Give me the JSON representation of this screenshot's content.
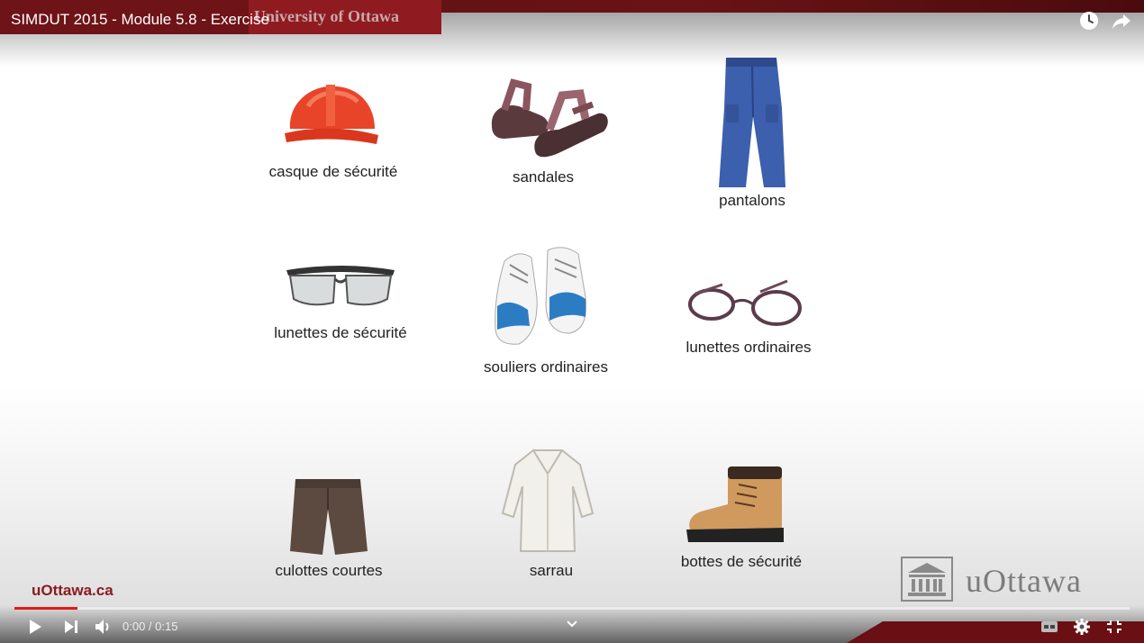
{
  "video": {
    "title": "SIMDUT 2015 - Module 5.8 - Exercise",
    "brand_ghost": "University of Ottawa"
  },
  "items": [
    {
      "label": "casque de sécurité",
      "icon": "hard-hat-icon"
    },
    {
      "label": "sandales",
      "icon": "sandals-icon"
    },
    {
      "label": "pantalons",
      "icon": "pants-icon"
    },
    {
      "label": "lunettes de sécurité",
      "icon": "safety-glasses-icon"
    },
    {
      "label": "souliers ordinaires",
      "icon": "sneakers-icon"
    },
    {
      "label": "lunettes ordinaires",
      "icon": "eyeglasses-icon"
    },
    {
      "label": "culottes courtes",
      "icon": "shorts-icon"
    },
    {
      "label": "sarrau",
      "icon": "lab-coat-icon"
    },
    {
      "label": "bottes de sécurité",
      "icon": "boot-icon"
    }
  ],
  "footer": {
    "url": "uOttawa.ca",
    "logo_text": "uOttawa"
  },
  "player": {
    "time": "0:00 / 0:15",
    "progress_fraction": 0.0
  },
  "colors": {
    "brand_red": "#8f1b20",
    "progress_red": "#e01b1b"
  }
}
